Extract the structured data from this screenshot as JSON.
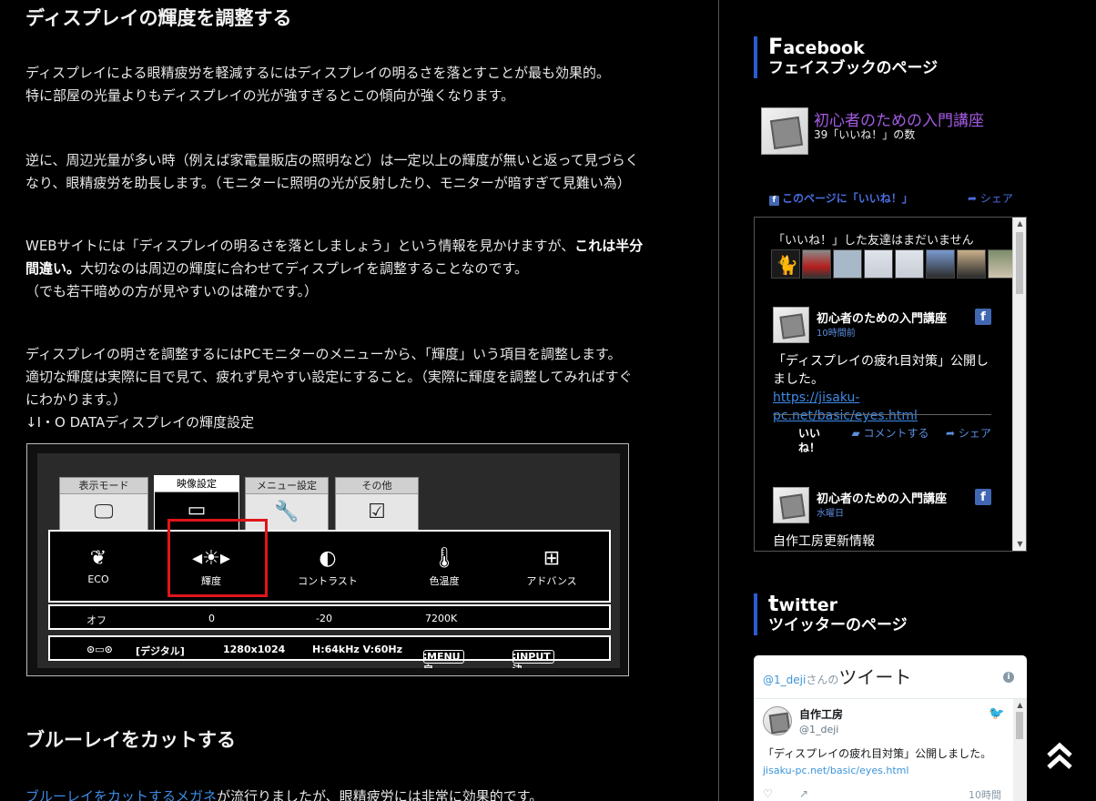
{
  "article": {
    "heading1": "ディスプレイの輝度を調整する",
    "p1_line1": "ディスプレイによる眼精疲労を軽減するにはディスプレイの明るさを落とすことが最も効果的。",
    "p1_line2": "特に部屋の光量よりもディスプレイの光が強すぎるとこの傾向が強くなります。",
    "p2_line1": "逆に、周辺光量が多い時（例えば家電量販店の照明など）は一定以上の輝度が無いと返って見づらく",
    "p2_line2": "なり、眼精疲労を助長します。（モニターに照明の光が反射したり、モニターが暗すぎて見難い為）",
    "p3_part1": "WEBサイトには「ディスプレイの明るさを落としましょう」という情報を見かけますが、",
    "p3_bold1": "これは半分",
    "p3_bold2": "間違い。",
    "p3_part2": "大切なのは周辺の輝度に合わせてディスプレイを調整することなのです。",
    "p3_line3": "（でも若干暗めの方が見やすいのは確かです。）",
    "p4_line1": "ディスプレイの明さを調整するにはPCモニターのメニューから、「輝度」いう項目を調整します。",
    "p4_line2": "適切な輝度は実際に目で見て、疲れず見やすい設定にすること。（実際に輝度を調整してみればすぐ",
    "p4_line3": "にわかります。）",
    "p4_line4": "↓I・O DATAディスプレイの輝度設定",
    "heading2": "ブルーレイをカットする",
    "p5_link": "ブルーレイをカットするメガネ",
    "p5_rest": "が流行りましたが、眼精疲労には非常に効果的です。"
  },
  "osd": {
    "tabs": [
      "表示モード",
      "映像設定",
      "メニュー設定",
      "その他"
    ],
    "items": [
      "ECO",
      "輝度",
      "コントラスト",
      "色温度",
      "アドバンス"
    ],
    "values": [
      "オフ",
      "0",
      "-20",
      "7200K"
    ],
    "status": {
      "mode": "[デジタル]",
      "resolution": "1280x1024",
      "freq": "H:64kHz V:60Hz",
      "menu_key": "MENU",
      "menu_action": ":戻る",
      "input_key": "INPUT",
      "input_action": ":決定"
    },
    "highlight_color": "#e0151b"
  },
  "sidebar": {
    "facebook": {
      "head_cap": "F",
      "head_rest": "acebook",
      "head_jp": "フェイスブックのページ",
      "page_name": "初心者のための入門講座",
      "likes": "39「いいね！」の数",
      "like_label": "このページに「いいね！」",
      "share_label": "シェア",
      "friends_note": "「いいね！」した友達はまだいません",
      "post1": {
        "author": "初心者のための入門講座",
        "time": "10時間前",
        "text": "「ディスプレイの疲れ目対策」公開しました。",
        "link": "https://jisaku-pc.net/basic/eyes.html",
        "action_like": "いいね！",
        "action_comment": "コメントする",
        "action_share": "シェア"
      },
      "post2": {
        "author": "初心者のための入門講座",
        "time": "水曜日",
        "text": "自作工房更新情報"
      },
      "accent": "#2c5bd1",
      "brand": "#4267b2"
    },
    "twitter": {
      "head_cap": "t",
      "head_rest": "witter",
      "head_jp": "ツイッターのページ",
      "handle": "@1_deji",
      "handle_suffix": "さんの",
      "title": "ツイート",
      "tweet": {
        "name": "自作工房",
        "user": "@1_deji",
        "text": "「ディスプレイの疲れ目対策」公開しました。",
        "link": "jisaku-pc.net/basic/eyes.html",
        "time": "10時間"
      }
    }
  },
  "icons": {
    "scroll_top": "double-chevron-up-icon"
  }
}
